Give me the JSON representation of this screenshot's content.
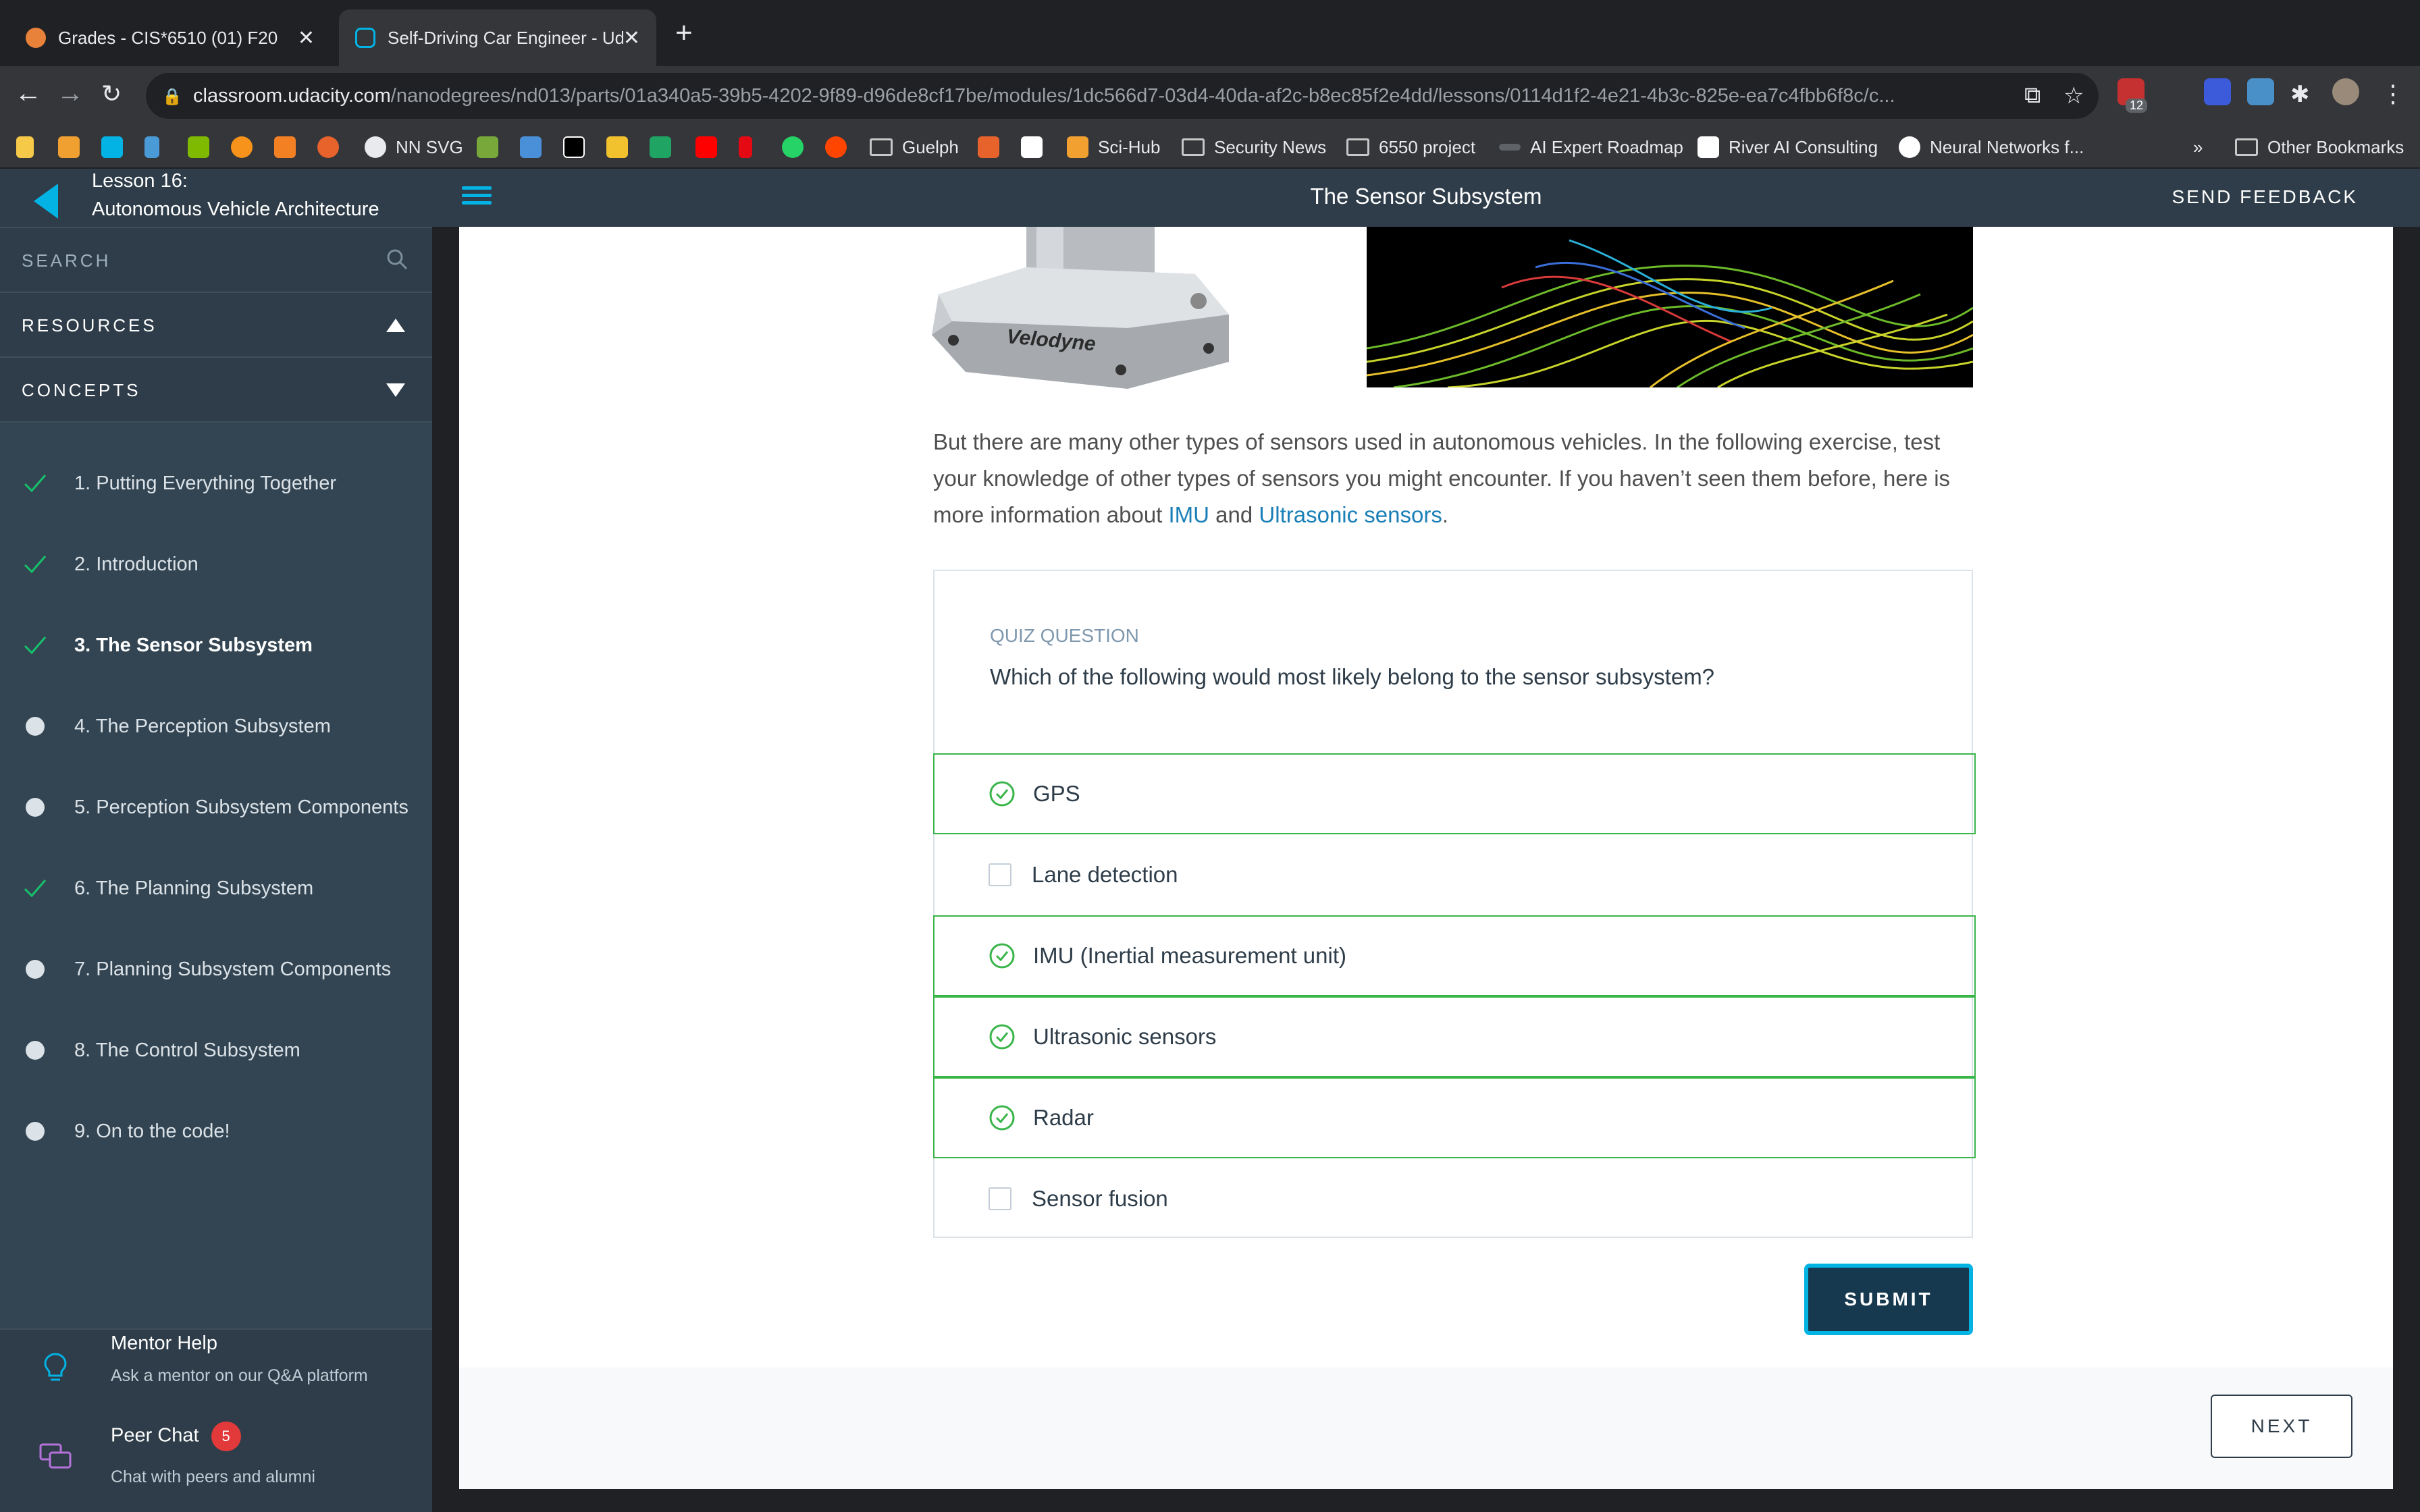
{
  "browser": {
    "tabs": [
      {
        "title": "Grades - CIS*6510 (01) F20 - C",
        "active": false
      },
      {
        "title": "Self-Driving Car Engineer - Ud",
        "active": true
      }
    ],
    "url_host": "classroom.udacity.com",
    "url_path": "/nanodegrees/nd013/parts/01a340a5-39b5-4202-9f89-d96de8cf17be/modules/1dc566d7-03d4-40da-af2c-b8ec85f2e4dd/lessons/0114d1f2-4e21-4b3c-825e-ea7c4fbb6f8c/c...",
    "extension_badge": "12",
    "bookmarks": [
      "NN SVG",
      "Guelph",
      "Sci-Hub",
      "Security News",
      "6550 project",
      "AI Expert Roadmap",
      "River AI Consulting",
      "Neural Networks f...",
      "Other Bookmarks"
    ],
    "bookmarks_overflow": "»"
  },
  "sidebar": {
    "lesson_number": "Lesson 16:",
    "lesson_title": "Autonomous Vehicle Architecture",
    "search_label": "SEARCH",
    "resources_label": "RESOURCES",
    "concepts_label": "CONCEPTS",
    "concepts": [
      {
        "label": "1. Putting Everything Together",
        "done": true
      },
      {
        "label": "2. Introduction",
        "done": true
      },
      {
        "label": "3. The Sensor Subsystem",
        "done": true
      },
      {
        "label": "4. The Perception Subsystem",
        "done": false
      },
      {
        "label": "5. Perception Subsystem Components",
        "done": false
      },
      {
        "label": "6. The Planning Subsystem",
        "done": true
      },
      {
        "label": "7. Planning Subsystem Components",
        "done": false
      },
      {
        "label": "8. The Control Subsystem",
        "done": false
      },
      {
        "label": "9. On to the code!",
        "done": false
      }
    ],
    "mentor_title": "Mentor Help",
    "mentor_sub": "Ask a mentor on our Q&A platform",
    "peer_title": "Peer Chat",
    "peer_badge": "5",
    "peer_sub": "Chat with peers and alumni"
  },
  "header": {
    "title": "The Sensor Subsystem",
    "feedback": "SEND FEEDBACK"
  },
  "content": {
    "velodyne_label": "Velodyne",
    "para_1": "But there are many other types of sensors used in autonomous vehicles. In the following exercise, test your knowledge of other types of sensors you might encounter. If you haven’t seen them before, here is more information about ",
    "link_imu": "IMU",
    "para_and": " and ",
    "link_ultrasonic": "Ultrasonic sensors",
    "para_end": ".",
    "quiz_label": "QUIZ QUESTION",
    "quiz_question": "Which of the following would most likely belong to the sensor subsystem?",
    "options": [
      {
        "label": "GPS",
        "checked": true
      },
      {
        "label": "Lane detection",
        "checked": false
      },
      {
        "label": "IMU (Inertial measurement unit)",
        "checked": true
      },
      {
        "label": "Ultrasonic sensors",
        "checked": true
      },
      {
        "label": "Radar",
        "checked": true
      },
      {
        "label": "Sensor fusion",
        "checked": false
      }
    ],
    "submit": "SUBMIT",
    "next": "NEXT"
  },
  "colors": {
    "accent": "#02b3e4",
    "check": "#3ab54a",
    "sidebar": "#2e3d49",
    "submit_bg": "#17394f"
  }
}
